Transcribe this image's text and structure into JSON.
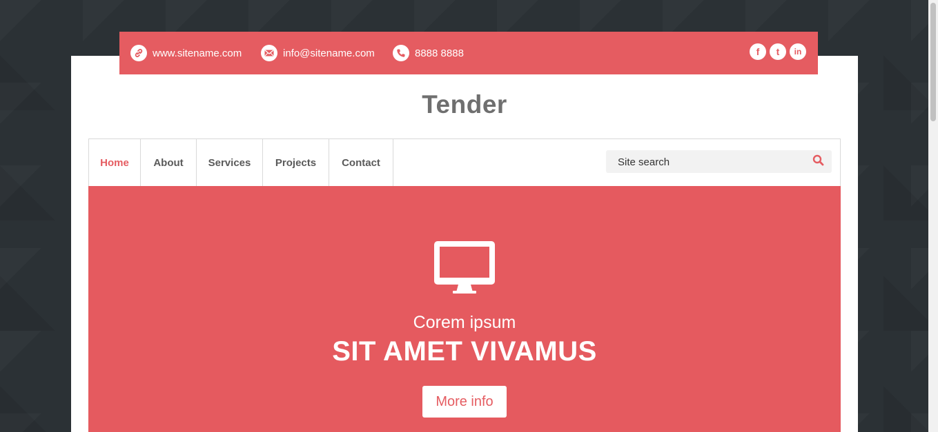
{
  "topbar": {
    "website": "www.sitename.com",
    "email": "info@sitename.com",
    "phone": "8888 8888",
    "social": [
      {
        "icon": "facebook-icon",
        "glyph": "f"
      },
      {
        "icon": "twitter-icon",
        "glyph": "t"
      },
      {
        "icon": "linkedin-icon",
        "glyph": "in"
      }
    ]
  },
  "site": {
    "title": "Tender"
  },
  "nav": {
    "items": [
      "Home",
      "About",
      "Services",
      "Projects",
      "Contact"
    ],
    "active": "Home"
  },
  "search": {
    "placeholder": "Site search",
    "icon": "search-icon"
  },
  "hero": {
    "icon": "monitor-icon",
    "subtitle": "Corem ipsum",
    "title": "SIT AMET VIVAMUS",
    "button_label": "More info"
  },
  "colors": {
    "accent": "#e55c61",
    "background": "#2b3135",
    "text": "#5a5a5a"
  }
}
